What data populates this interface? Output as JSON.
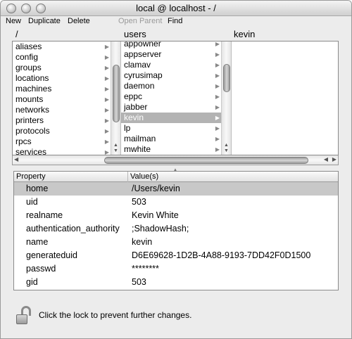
{
  "window": {
    "title": "local @ localhost - /"
  },
  "toolbar": {
    "new": "New",
    "duplicate": "Duplicate",
    "delete": "Delete",
    "open_parent": "Open Parent",
    "find": "Find"
  },
  "browser": {
    "headers": [
      "/",
      "users",
      "kevin"
    ],
    "col1": [
      "aliases",
      "config",
      "groups",
      "locations",
      "machines",
      "mounts",
      "networks",
      "printers",
      "protocols",
      "rpcs",
      "services"
    ],
    "col2": [
      "appowner",
      "appserver",
      "clamav",
      "cyrusimap",
      "daemon",
      "eppc",
      "jabber",
      "kevin",
      "lp",
      "mailman",
      "mwhite"
    ],
    "col2_selected": "kevin"
  },
  "properties": {
    "header_property": "Property",
    "header_values": "Value(s)",
    "rows": [
      {
        "property": "home",
        "value": "/Users/kevin"
      },
      {
        "property": "uid",
        "value": "503"
      },
      {
        "property": "realname",
        "value": "Kevin White"
      },
      {
        "property": "authentication_authority",
        "value": ";ShadowHash;"
      },
      {
        "property": "name",
        "value": "kevin"
      },
      {
        "property": "generateduid",
        "value": "D6E69628-1D2B-4A88-9193-7DD42F0D1500"
      },
      {
        "property": "passwd",
        "value": "********"
      },
      {
        "property": "gid",
        "value": "503"
      }
    ]
  },
  "lock": {
    "message": "Click the lock to prevent further changes.",
    "icon": "unlocked-padlock-icon"
  }
}
